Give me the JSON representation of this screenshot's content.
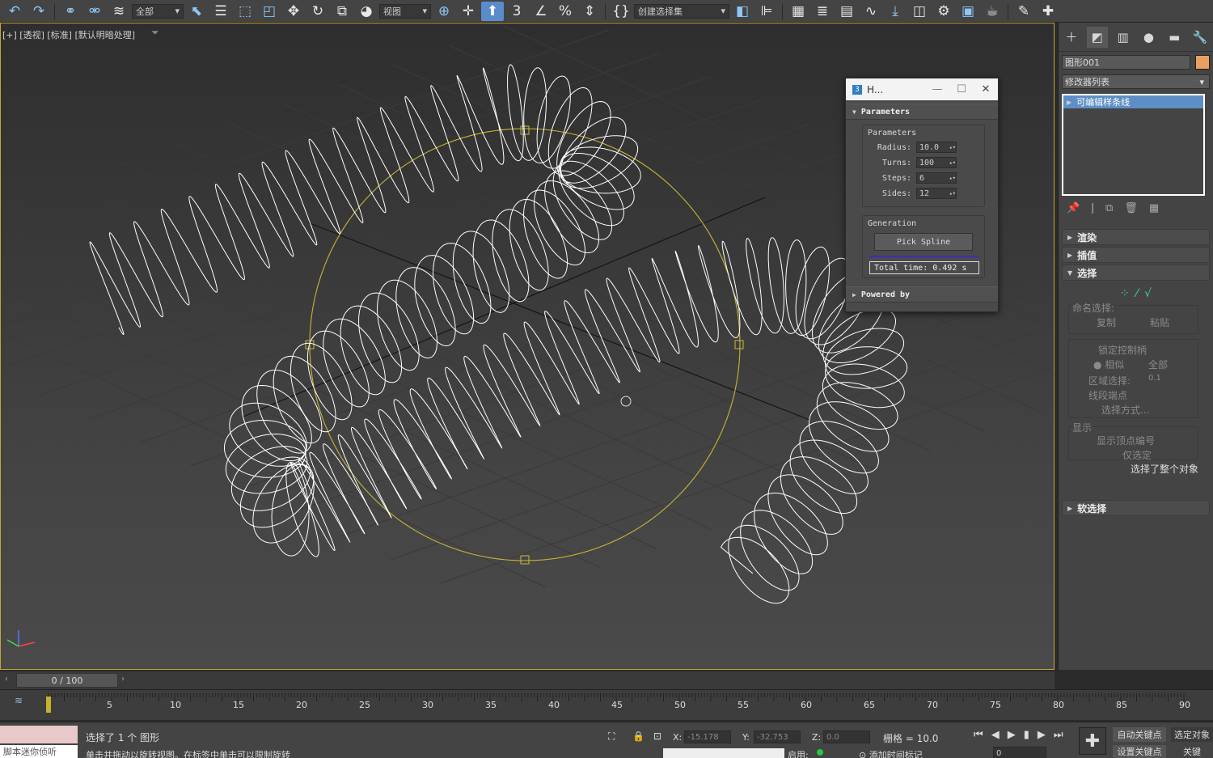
{
  "toolbar": {
    "selection_filter": "全部",
    "ref_coord": "视图",
    "named_selection": "创建选择集"
  },
  "viewport": {
    "label": "[+] [透视] [标准] [默认明暗处理]"
  },
  "dialog": {
    "title": "H...",
    "rollout_parameters": "Parameters",
    "group_parameters": "Parameters",
    "params": [
      {
        "label": "Radius:",
        "value": "10.0"
      },
      {
        "label": "Turns:",
        "value": "100"
      },
      {
        "label": "Steps:",
        "value": "6"
      },
      {
        "label": "Sides:",
        "value": "12"
      }
    ],
    "group_generation": "Generation",
    "pick_spline": "Pick Spline",
    "total_time": "Total time: 0.492 s",
    "rollout_powered": "Powered by"
  },
  "command_panel": {
    "object_name": "图形001",
    "modifier_list": "修改器列表",
    "stack_item": "可编辑样条线",
    "rollouts": {
      "render": "渲染",
      "interp": "插值",
      "select": "选择",
      "soft": "软选择"
    },
    "named_sel": "命名选择:",
    "copy": "复制",
    "paste": "粘贴",
    "lock_handles": "锁定控制柄",
    "alike": "相似",
    "all": "全部",
    "area_sel": "区域选择:",
    "area_val": "0.1",
    "seg_end": "线段端点",
    "sel_by": "选择方式...",
    "display": "显示",
    "show_vert_num": "显示顶点编号",
    "only_sel": "仅选定",
    "sel_info": "选择了整个对象",
    "color": "#e8a060"
  },
  "timeline": {
    "frame": "0 / 100",
    "ticks": [
      "5",
      "10",
      "15",
      "20",
      "25",
      "30",
      "35",
      "40",
      "45",
      "50",
      "55",
      "60",
      "65",
      "70",
      "75",
      "80",
      "85",
      "90"
    ]
  },
  "status": {
    "script_label": "脚本迷你侦听",
    "selected": "选择了 1 个 图形",
    "prompt": "单击并拖动以旋转视图。在标签中单击可以限制旋转",
    "x_label": "X:",
    "x_val": "-15.178",
    "y_label": "Y:",
    "y_val": "-32.753",
    "z_label": "Z:",
    "z_val": "0.0",
    "grid": "栅格 = 10.0",
    "enable": "启用:",
    "add_time_tag": "添加时间标记",
    "auto_key": "自动关键点",
    "sel_obj": "选定对象",
    "set_key": "设置关键点",
    "key_filters": "关键",
    "frame_field": "0"
  }
}
